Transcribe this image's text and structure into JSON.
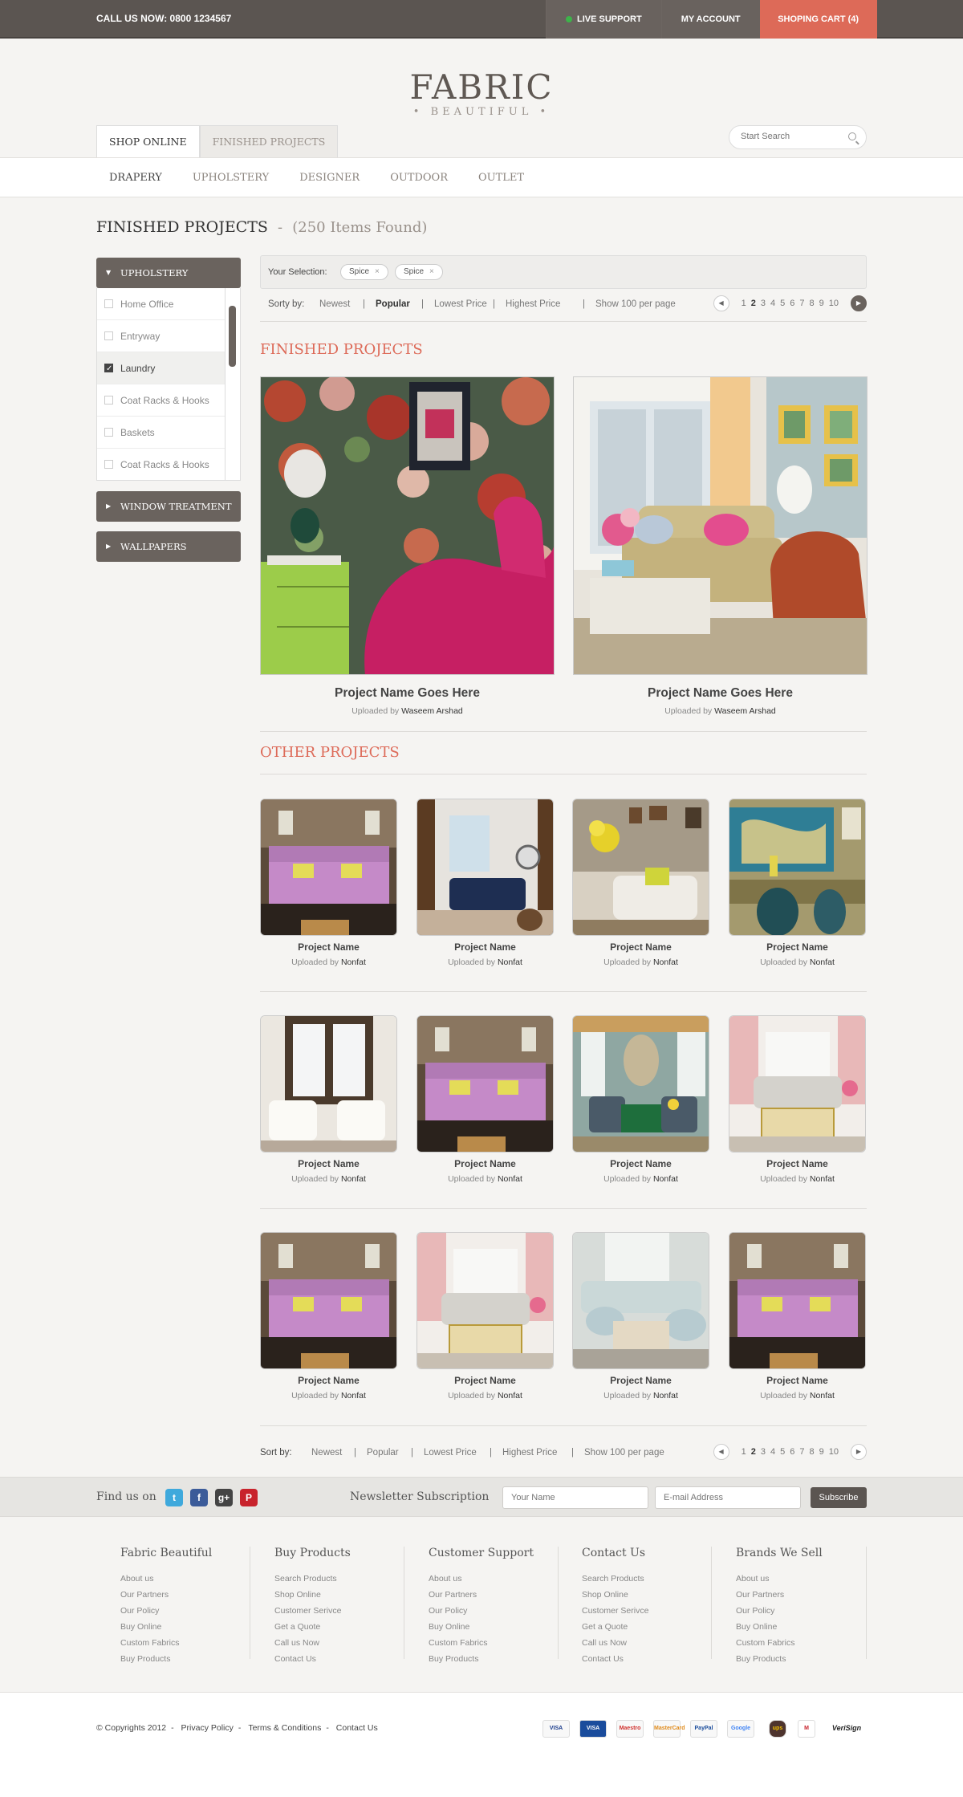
{
  "topbar": {
    "call_label": "CALL US NOW:  0800 1234567",
    "live_support": "LIVE SUPPORT",
    "my_account": "MY ACCOUNT",
    "cart": "SHOPING CART (4)"
  },
  "logo": {
    "line1": "FABRIC",
    "line2": "• BEAUTIFUL •"
  },
  "tabs": [
    "SHOP ONLINE",
    "FINISHED PROJECTS"
  ],
  "search": {
    "placeholder": "Start Search"
  },
  "categories": [
    "DRAPERY",
    "UPHOLSTERY",
    "DESIGNER",
    "OUTDOOR",
    "OUTLET"
  ],
  "page_title": {
    "title": "FINISHED PROJECTS",
    "sep": "-",
    "count": "(250 Items Found)"
  },
  "sidebar": {
    "upholstery": "UPHOLSTERY",
    "items": [
      {
        "label": "Home Office",
        "checked": false
      },
      {
        "label": "Entryway",
        "checked": false
      },
      {
        "label": "Laundry",
        "checked": true
      },
      {
        "label": "Coat Racks & Hooks",
        "checked": false
      },
      {
        "label": "Baskets",
        "checked": false
      },
      {
        "label": "Coat Racks & Hooks",
        "checked": false
      }
    ],
    "window_treatment": "WINDOW TREATMENT",
    "wallpapers": "WALLPAPERS"
  },
  "filter": {
    "label": "Your Selection:",
    "chips": [
      "Spice",
      "Spice"
    ],
    "chip_close": "×"
  },
  "sort": {
    "label": "Sorty by:",
    "bottom_label": "Sort by:",
    "options": [
      "Newest",
      "Popular",
      "Lowest Price",
      "Highest Price",
      "Show 100 per page"
    ],
    "sep": "|",
    "pages": [
      "1",
      "2",
      "3",
      "4",
      "5",
      "6",
      "7",
      "8",
      "9",
      "10"
    ],
    "prev": "◀",
    "next": "▶"
  },
  "finished": {
    "heading": "FINISHED PROJECTS",
    "items": [
      {
        "name": "Project Name Goes Here",
        "by": "Uploaded by",
        "author": "Waseem Arshad"
      },
      {
        "name": "Project Name Goes Here",
        "by": "Uploaded by",
        "author": "Waseem Arshad"
      }
    ]
  },
  "other": {
    "heading": "OTHER PROJECTS",
    "name": "Project Name",
    "by": "Uploaded by",
    "author": "Nonfat"
  },
  "newsletter": {
    "find_us": "Find us on",
    "title": "Newsletter Subscription",
    "name_placeholder": "Your Name",
    "email_placeholder": "E-mail Address",
    "subscribe": "Subscribe"
  },
  "social": [
    "t",
    "f",
    "g+",
    "P"
  ],
  "footer": {
    "columns": [
      {
        "title": "Fabric Beautiful",
        "links": [
          "About us",
          "Our Partners",
          "Our Policy",
          "Buy Online",
          "Custom Fabrics",
          "Buy Products"
        ]
      },
      {
        "title": "Buy Products",
        "links": [
          "Search Products",
          "Shop Online",
          "Customer Serivce",
          "Get a Quote",
          "Call us Now",
          "Contact Us"
        ]
      },
      {
        "title": "Customer Support",
        "links": [
          "About us",
          "Our Partners",
          "Our Policy",
          "Buy Online",
          "Custom Fabrics",
          "Buy Products"
        ]
      },
      {
        "title": "Contact Us",
        "links": [
          "Search Products",
          "Shop Online",
          "Customer Serivce",
          "Get a Quote",
          "Call us Now",
          "Contact Us"
        ]
      },
      {
        "title": "Brands We Sell",
        "links": [
          "About us",
          "Our Partners",
          "Our Policy",
          "Buy Online",
          "Custom Fabrics",
          "Buy Products"
        ]
      }
    ],
    "copyright": "© Copyrights 2012",
    "links": [
      "Privacy Policy",
      "Terms & Conditions",
      "Contact Us"
    ],
    "payments": [
      "VISA",
      "VISA",
      "Maestro",
      "MasterCard",
      "PayPal",
      "Google",
      "ups",
      "M",
      "VeriSign"
    ]
  },
  "colors": {
    "accent": "#dd6a58",
    "dark": "#5b5551",
    "sidebar": "#6a635e"
  }
}
